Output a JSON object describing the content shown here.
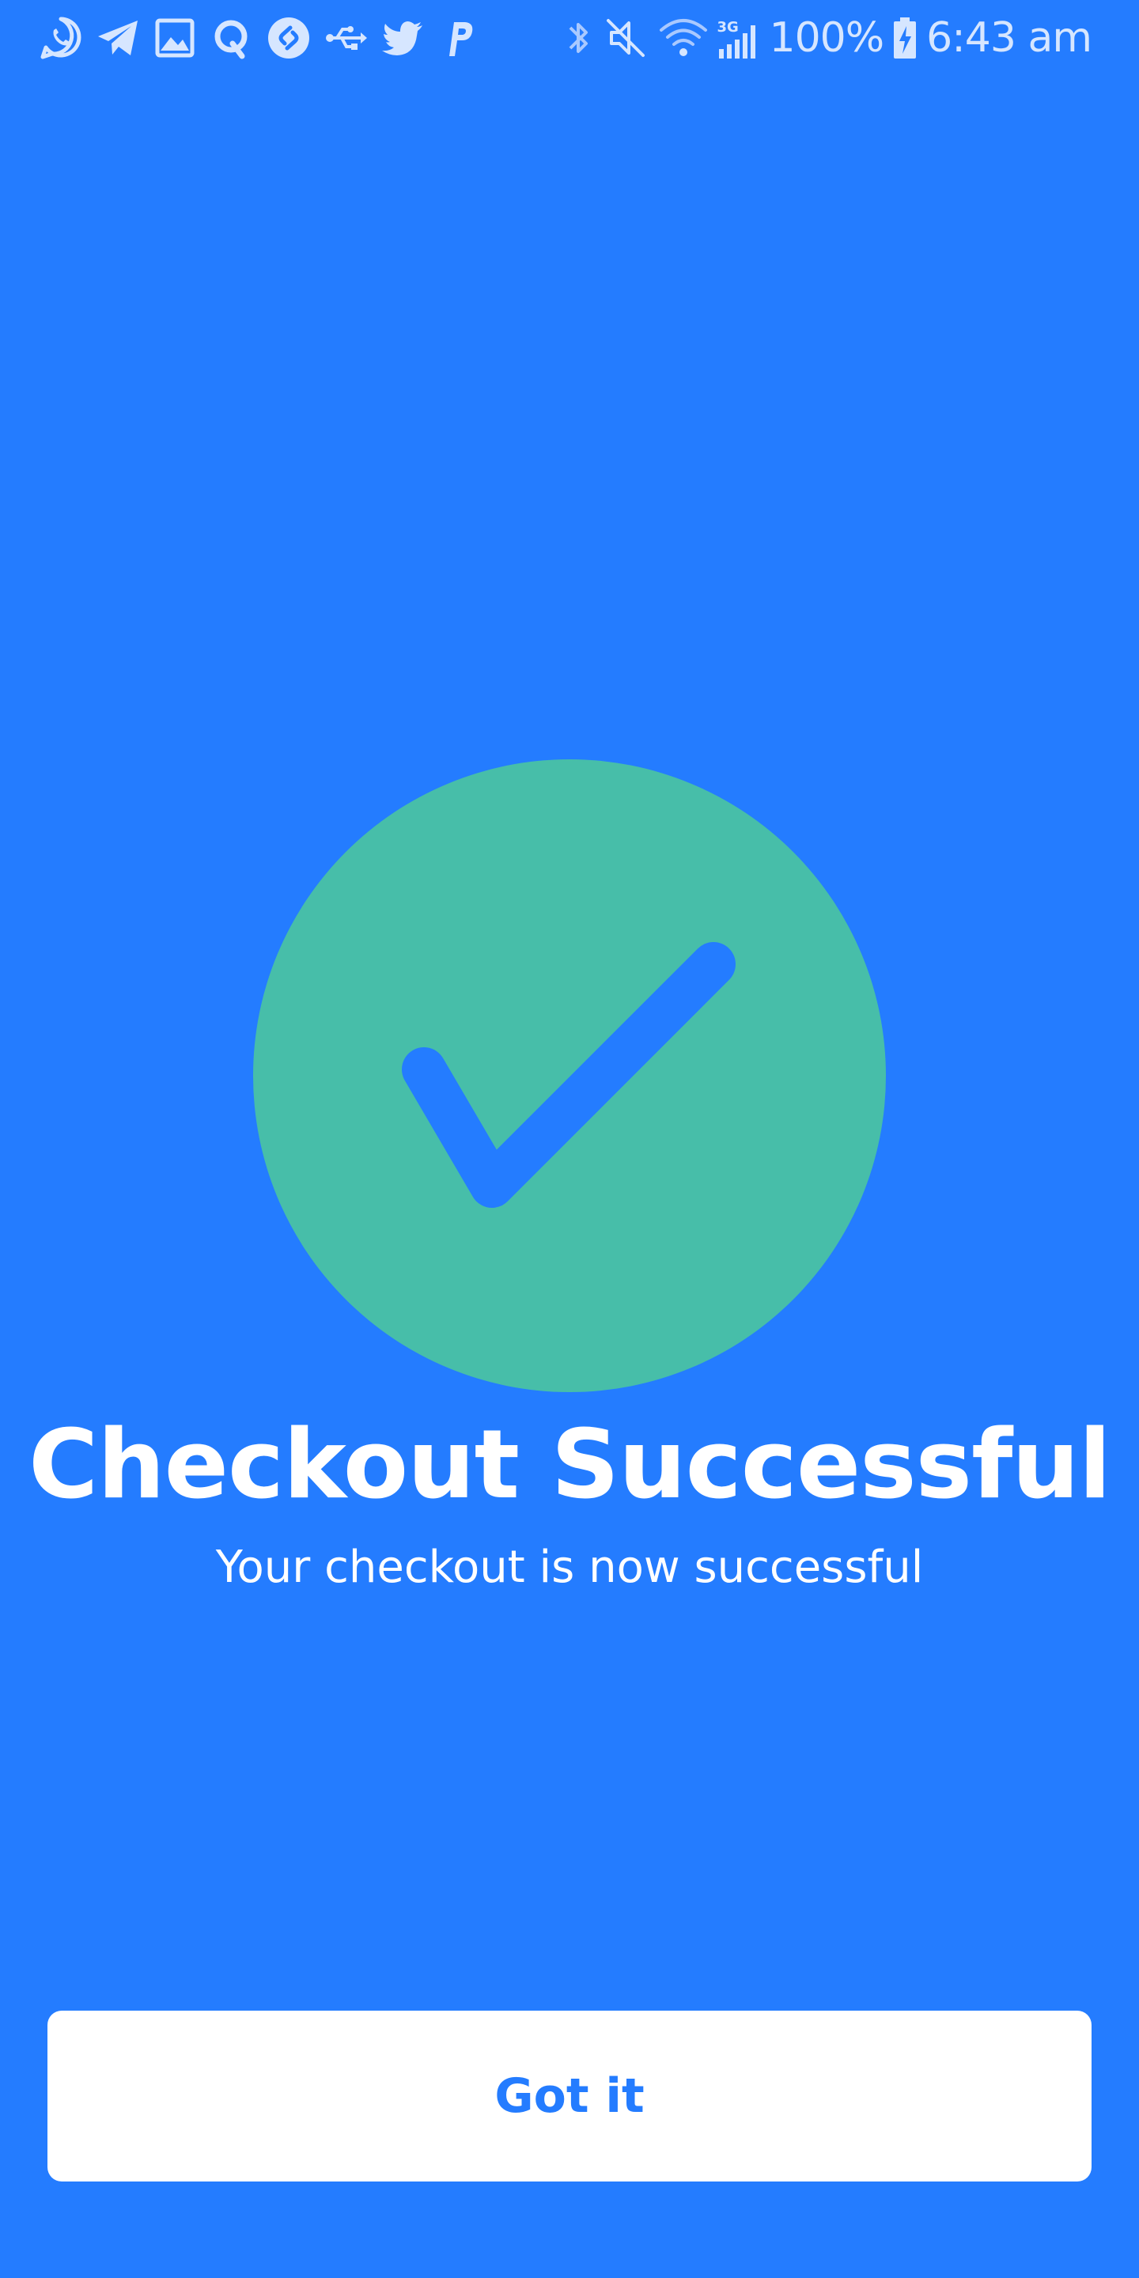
{
  "colors": {
    "background": "#247CFF",
    "success": "#47BEA9",
    "button_background": "#FFFFFF",
    "button_text": "#247CFF",
    "text_light": "#FFFFFF",
    "status_icons": "#D6E6FF"
  },
  "status_bar": {
    "left_icons": [
      "whatsapp-icon",
      "telegram-icon",
      "image-icon",
      "quora-icon",
      "shazam-icon",
      "usb-icon",
      "twitter-icon",
      "paypal-icon"
    ],
    "right_icons": [
      "bluetooth-icon",
      "mute-icon",
      "wifi-icon",
      "cellular-signal-icon",
      "battery-charging-icon"
    ],
    "network_type": "3G",
    "battery": "100%",
    "time": "6:43 am"
  },
  "main": {
    "icon": "checkmark-circle-icon",
    "title": "Checkout Successful",
    "subtitle": "Your checkout is now successful"
  },
  "actions": {
    "got_it_label": "Got it"
  }
}
